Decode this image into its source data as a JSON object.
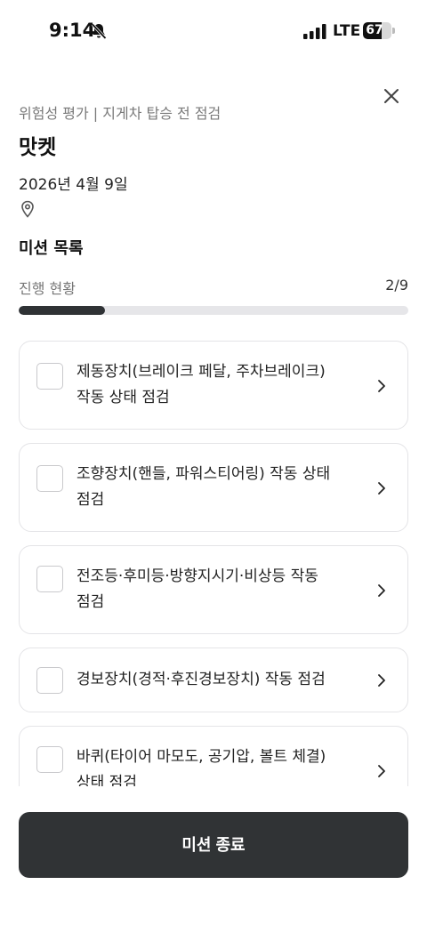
{
  "status_bar": {
    "time": "9:14",
    "network": "LTE",
    "battery": "67",
    "battery_level": 0.67
  },
  "header": {
    "breadcrumb": "위험성 평가 | 지게차 탑승 전 점검",
    "store_name": "맛켓",
    "date": "2026년 4월 9일"
  },
  "missions": {
    "section_title": "미션 목록",
    "progress_label": "진행 현황",
    "progress_count": "2/9",
    "progress_fraction": 0.222,
    "items": [
      {
        "label": "제동장치(브레이크 페달, 주차브레이크)\n작동 상태 점검",
        "checked": true
      },
      {
        "label": "조향장치(핸들, 파워스티어링) 작동 상태\n점검",
        "checked": true
      },
      {
        "label": "전조등·후미등·방향지시기·비상등 작동\n점검",
        "checked": false
      },
      {
        "label": "경보장치(경적·후진경보장치) 작동 점검",
        "checked": false
      },
      {
        "label": "바퀴(타이어 마모도, 공기압, 볼트 체결)\n상태 점검",
        "checked": false
      }
    ]
  },
  "footer": {
    "end_button_label": "미션 종료"
  },
  "colors": {
    "primary_dark": "#2f3235",
    "muted_text": "#7a7a7a",
    "card_border": "#e4e4e7"
  }
}
